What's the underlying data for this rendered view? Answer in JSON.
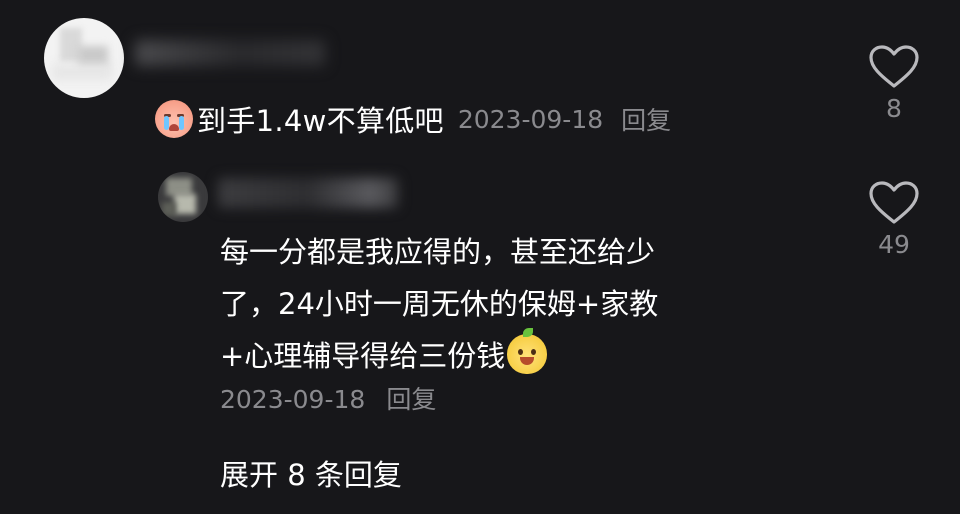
{
  "main_comment": {
    "text": "到手1.4w不算低吧",
    "emoji": "crying-emoji",
    "date": "2023-09-18",
    "reply_label": "回复",
    "like_count": "8"
  },
  "reply_comment": {
    "lines": [
      "每一分都是我应得的，甚至还给少",
      "了，24小时一周无休的保姆+家教",
      "+心理辅导得给三份钱"
    ],
    "emoji": "grinning-fruit-emoji",
    "date": "2023-09-18",
    "reply_label": "回复",
    "like_count": "49"
  },
  "expand_replies_label": "展开 8 条回复",
  "colors": {
    "background": "#17171a",
    "primary_text": "#ffffff",
    "secondary_text": "#8a8a8e"
  }
}
